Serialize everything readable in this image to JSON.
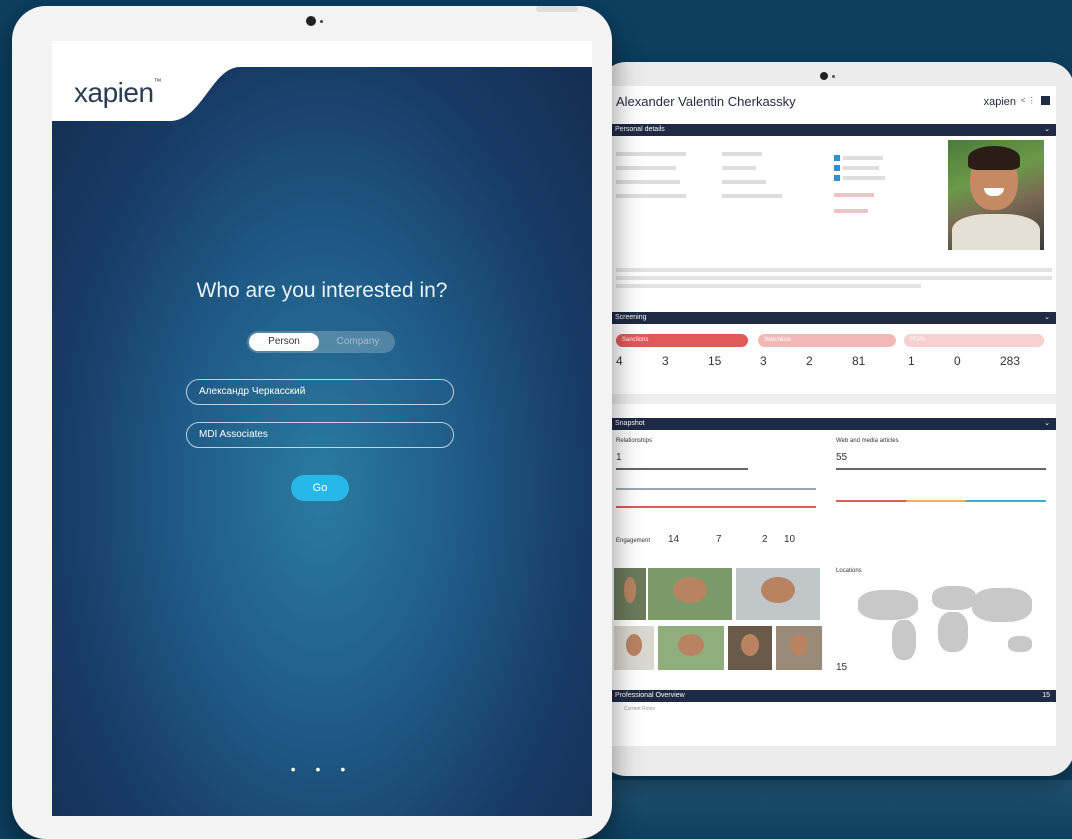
{
  "front": {
    "logo": "xapien",
    "question": "Who are you interested in?",
    "toggle": {
      "selected": "Person",
      "other": "Company"
    },
    "name_field": "Александр Черкасский",
    "org_field": "MDI Associates",
    "go_label": "Go",
    "dots": "• • •"
  },
  "report": {
    "subject_name": "Alexander Valentin Cherkassky",
    "logo": "xapien",
    "sections": {
      "personal": "Personal details",
      "screening": "Screening",
      "snapshot": "Snapshot",
      "professional": "Professional Overview"
    },
    "screening_pills": [
      "Sanctions",
      "Watchlists",
      "PEPs"
    ],
    "screening_numbers": [
      "4",
      "3",
      "15",
      "3",
      "2",
      "81",
      "1",
      "0",
      "283"
    ],
    "snapshot": {
      "relationships_label": "Relationships",
      "relationships_count": "1",
      "web_label": "Web and media articles",
      "web_count": "55",
      "engagement_label": "Engagement",
      "engagement_values": [
        "14",
        "7",
        "2",
        "10"
      ],
      "locations_label": "Locations",
      "locations_count": "15"
    },
    "prof_count": "15",
    "prof_sub": "Current Roles"
  },
  "colors": {
    "navy": "#1f2a44",
    "accent": "#27b8e8",
    "sanctions": "#e05a5a",
    "watchlists": "#f2b8b8",
    "peps": "#f6d0d0"
  }
}
